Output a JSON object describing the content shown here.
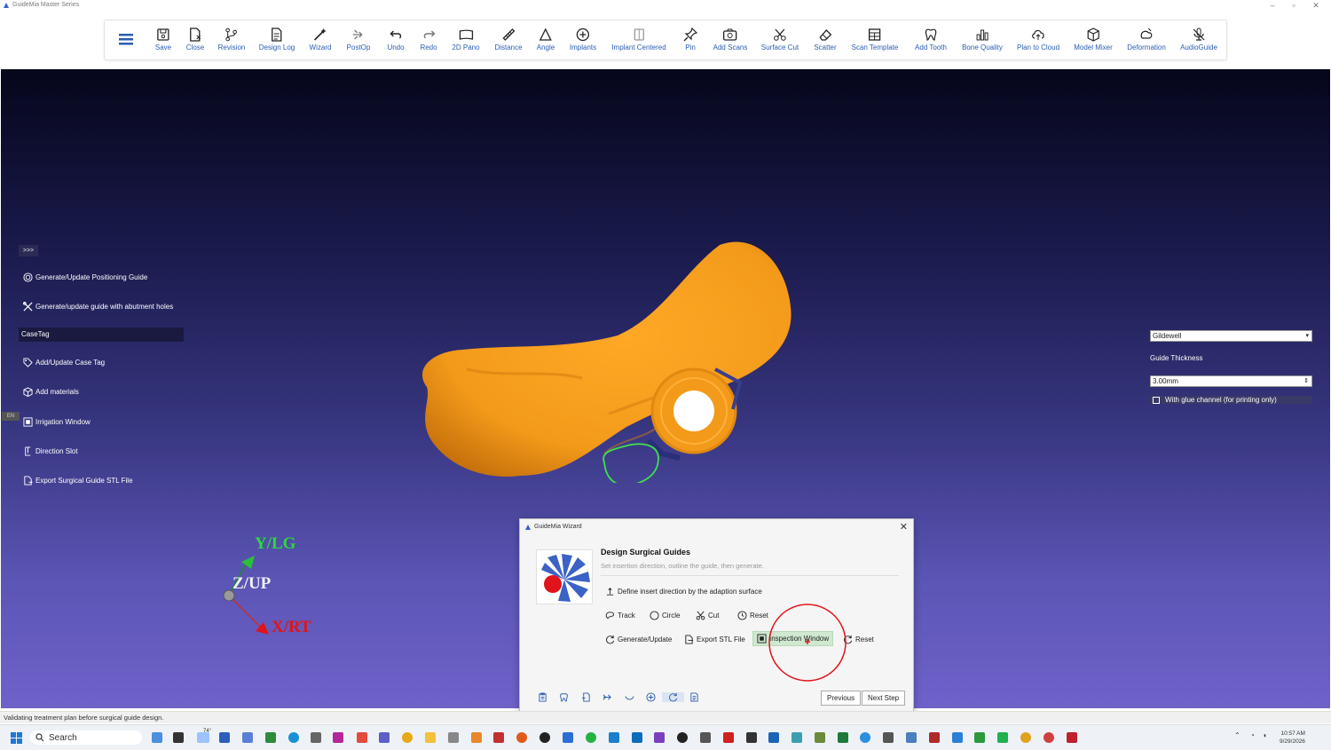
{
  "window": {
    "title": "GuideMia Master Series"
  },
  "toolbar": {
    "items": [
      {
        "label": "Save",
        "icon": "save-icon"
      },
      {
        "label": "Close",
        "icon": "close-file-icon"
      },
      {
        "label": "Revision",
        "icon": "revision-icon"
      },
      {
        "label": "Design Log",
        "icon": "design-log-icon"
      },
      {
        "label": "Wizard",
        "icon": "wizard-icon"
      },
      {
        "label": "PostOp",
        "icon": "postop-icon"
      },
      {
        "label": "Undo",
        "icon": "undo-icon"
      },
      {
        "label": "Redo",
        "icon": "redo-icon"
      },
      {
        "label": "2D Pano",
        "icon": "pano-icon"
      },
      {
        "label": "Distance",
        "icon": "ruler-icon"
      },
      {
        "label": "Angle",
        "icon": "angle-icon"
      },
      {
        "label": "Implants",
        "icon": "implant-icon"
      },
      {
        "label": "Implant Centered",
        "icon": "implant-centered-icon"
      },
      {
        "label": "Pin",
        "icon": "pin-icon"
      },
      {
        "label": "Add Scans",
        "icon": "camera-icon"
      },
      {
        "label": "Surface Cut",
        "icon": "scissors-icon"
      },
      {
        "label": "Scatter",
        "icon": "eraser-icon"
      },
      {
        "label": "Scan Template",
        "icon": "template-icon"
      },
      {
        "label": "Add Tooth",
        "icon": "tooth-icon"
      },
      {
        "label": "Bone Quality",
        "icon": "bar-chart-icon"
      },
      {
        "label": "Plan to Cloud",
        "icon": "cloud-upload-icon"
      },
      {
        "label": "Model Mixer",
        "icon": "cube-icon"
      },
      {
        "label": "Deformation",
        "icon": "deformation-icon"
      },
      {
        "label": "AudioGuide",
        "icon": "mic-off-icon"
      }
    ]
  },
  "sidebar": {
    "toggle": ">>>",
    "items": [
      {
        "label": "Generate/Update Positioning Guide",
        "icon": "target-icon"
      },
      {
        "label": "Generate/update guide with abutment holes",
        "icon": "tools-icon"
      },
      {
        "label": "Add/Update Case Tag",
        "icon": "tag-icon"
      },
      {
        "label": "Add materials",
        "icon": "box-icon"
      },
      {
        "label": "Irrigation Window",
        "icon": "window-icon"
      },
      {
        "label": "Direction Slot",
        "icon": "slot-icon"
      },
      {
        "label": "Export Surgical Guide STL File",
        "icon": "export-icon"
      }
    ],
    "casetag_field": "CaseTag",
    "lang_tab": "EN"
  },
  "right_panel": {
    "lab_select": "Gildewell",
    "thickness_label": "Guide Thickness",
    "thickness_value": "3.00mm",
    "glue_channel_label": "With glue channel (for printing only)",
    "glue_channel_checked": false
  },
  "axes": {
    "y": "Y/LG",
    "z": "Z/UP",
    "x": "X/RT"
  },
  "wizard": {
    "title": "GuideMia Wizard",
    "heading": "Design Surgical Guides",
    "subtitle": "Set insertion direction, outline the guide, then generate.",
    "define_direction": "Define insert direction by the adaption surface",
    "row1": [
      {
        "label": "Track",
        "icon": "lasso-icon"
      },
      {
        "label": "Circle",
        "icon": "circle-icon"
      },
      {
        "label": "Cut",
        "icon": "scissors-icon"
      },
      {
        "label": "Reset",
        "icon": "reset-icon"
      }
    ],
    "row2": [
      {
        "label": "Generate/Update",
        "icon": "refresh-icon"
      },
      {
        "label": "Export STL File",
        "icon": "export-icon"
      },
      {
        "label": "Inspection Window",
        "icon": "window-icon"
      },
      {
        "label": "Reset",
        "icon": "reset-icon"
      }
    ],
    "previous": "Previous",
    "next": "Next Step"
  },
  "status": "Validating treatment plan before surgical guide design.",
  "taskbar": {
    "search": "Search",
    "weather": "74°",
    "time": "10:57 AM",
    "date": "9/29/2026"
  },
  "colors": {
    "model": "#f39a1a",
    "accent_link": "#2a5db0",
    "highlight": "#cfe8cf",
    "annotation": "#e0141a"
  }
}
